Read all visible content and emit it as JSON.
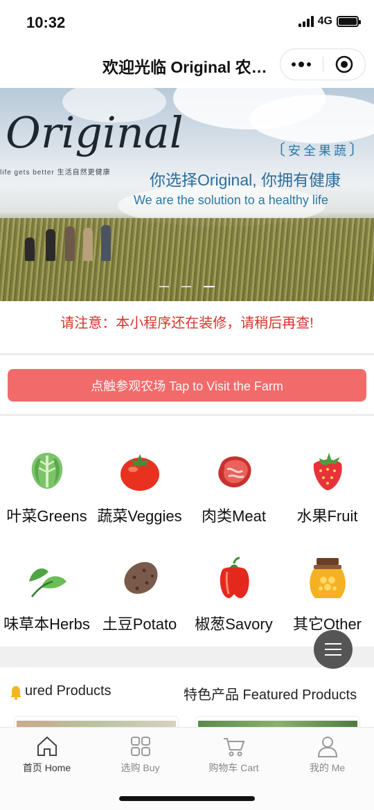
{
  "status_bar": {
    "time": "10:32",
    "network": "4G"
  },
  "nav": {
    "title": "欢迎光临 Original 农…",
    "more_icon": "more-dots-icon",
    "close_icon": "target-circle-icon"
  },
  "banner": {
    "logo": "Original",
    "logo_sub": "life gets better  生活自然更健康",
    "tag": "安全果蔬",
    "slogan_cn": "你选择Original, 你拥有健康",
    "slogan_en": "We are the solution to a healthy life",
    "page_count": 3,
    "active_page": 3
  },
  "notice": "请注意：本小程序还在装修，请稍后再查!",
  "visit_button": "点触参观农场 Tap to Visit the Farm",
  "categories": [
    {
      "label": "叶菜Greens",
      "icon": "lettuce-icon"
    },
    {
      "label": "蔬菜Veggies",
      "icon": "tomato-icon"
    },
    {
      "label": "肉类Meat",
      "icon": "steak-icon"
    },
    {
      "label": "水果Fruit",
      "icon": "strawberry-icon"
    },
    {
      "label": "味草本Herbs",
      "icon": "leaf-icon"
    },
    {
      "label": "土豆Potato",
      "icon": "potato-icon"
    },
    {
      "label": "椒葱Savory",
      "icon": "pepper-icon"
    },
    {
      "label": "其它Other",
      "icon": "honey-jar-icon"
    }
  ],
  "featured": {
    "left_label": "ured Products",
    "right_label": "特色产品 Featured Products"
  },
  "tabs": [
    {
      "label": "首页 Home",
      "icon": "home-icon",
      "active": true
    },
    {
      "label": "选购 Buy",
      "icon": "grid-icon",
      "active": false
    },
    {
      "label": "购物车 Cart",
      "icon": "cart-icon",
      "active": false
    },
    {
      "label": "我的 Me",
      "icon": "person-icon",
      "active": false
    }
  ],
  "colors": {
    "accent": "#f16b6b",
    "notice": "#d7332b",
    "slogan": "#2a79a8"
  }
}
